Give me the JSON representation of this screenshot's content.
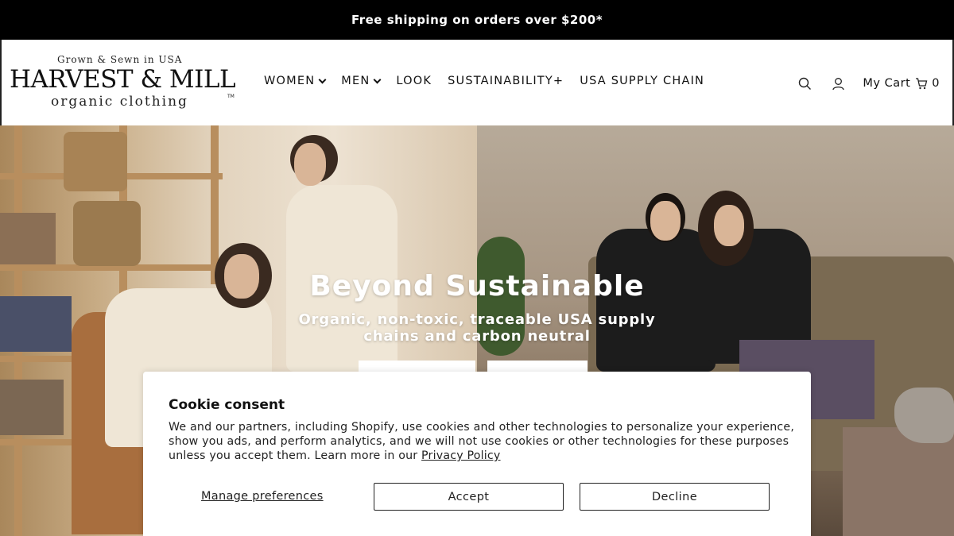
{
  "announcement": {
    "text": "Free shipping on orders over $200*"
  },
  "logo": {
    "tagline_top": "Grown & Sewn in USA",
    "brand": "HARVEST & MILL",
    "tagline_bottom": "organic clothing",
    "tm": "TM"
  },
  "nav": {
    "items": [
      {
        "label": "WOMEN",
        "has_dropdown": true
      },
      {
        "label": "MEN",
        "has_dropdown": true
      },
      {
        "label": "LOOK",
        "has_dropdown": false
      },
      {
        "label": "SUSTAINABILITY+",
        "has_dropdown": false
      },
      {
        "label": "USA SUPPLY CHAIN",
        "has_dropdown": false
      }
    ]
  },
  "header_icons": {
    "search_icon": "search-icon",
    "account_icon": "user-icon",
    "cart_label": "My Cart",
    "cart_icon": "shopping-cart-icon",
    "cart_count": "0"
  },
  "hero": {
    "title": "Beyond Sustainable",
    "subtitle": "Organic, non-toxic, traceable USA supply chains and carbon neutral"
  },
  "cookie": {
    "title": "Cookie consent",
    "body": "We and our partners, including Shopify, use cookies and other technologies to personalize your experience, show you ads, and perform analytics, and we will not use cookies or other technologies for these purposes unless you accept them. Learn more in our",
    "policy_link": "Privacy Policy",
    "manage_label": "Manage preferences",
    "accept_label": "Accept",
    "decline_label": "Decline"
  },
  "colors": {
    "announcement_bg": "#000000",
    "text": "#111111",
    "background": "#ffffff"
  }
}
